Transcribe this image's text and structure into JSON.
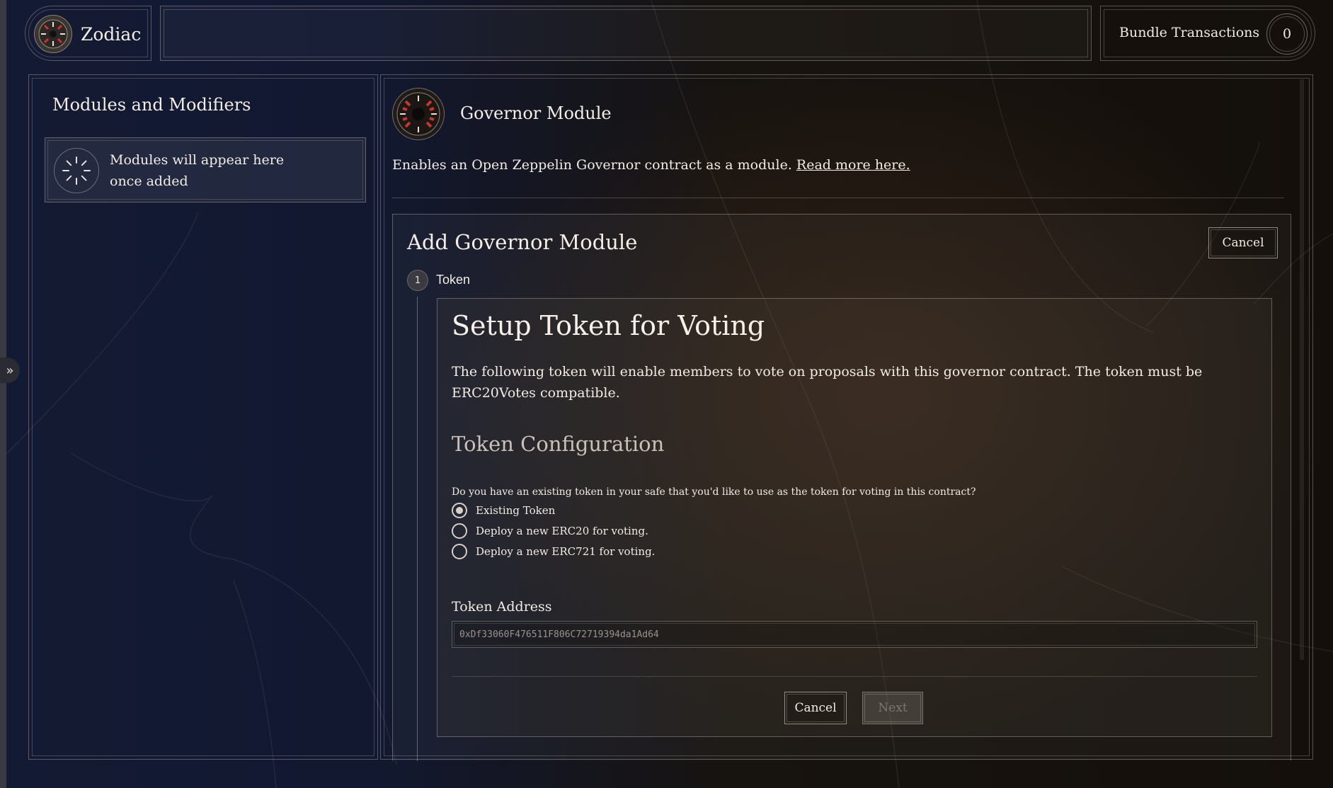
{
  "app": {
    "name": "Zodiac"
  },
  "header": {
    "bundle_label": "Bundle Transactions",
    "bundle_count": "0"
  },
  "sidebar": {
    "title": "Modules and Modifiers",
    "empty_line1": "Modules will appear here",
    "empty_line2": "once added"
  },
  "module": {
    "title": "Governor Module",
    "description": "Enables an Open Zeppelin Governor contract as a module.",
    "read_more": "Read more here."
  },
  "add_panel": {
    "title": "Add Governor Module",
    "cancel_label": "Cancel",
    "step_number": "1",
    "step_label": "Token"
  },
  "setup": {
    "title": "Setup Token for Voting",
    "description": "The following token will enable members to vote on proposals with this governor contract. The token must be ERC20Votes compatible.",
    "config_title": "Token Configuration",
    "question": "Do you have an existing token in your safe that you'd like to use as the token for voting in this contract?",
    "options": [
      {
        "label": "Existing Token",
        "selected": true
      },
      {
        "label": "Deploy a new ERC20 for voting.",
        "selected": false
      },
      {
        "label": "Deploy a new ERC721 for voting.",
        "selected": false
      }
    ],
    "token_address_label": "Token Address",
    "token_address_value": "0xDf33060F476511F806C72719394da1Ad64",
    "cancel_label": "Cancel",
    "next_label": "Next"
  },
  "icons": {
    "expand": "double-chevron-right-icon",
    "logo": "zodiac-logo-icon",
    "spinner": "loading-spinner-icon",
    "module": "governor-module-icon"
  },
  "colors": {
    "text": "#f2ece4",
    "muted_heading": "#c9c1b8",
    "disabled_text": "#7d766f"
  }
}
